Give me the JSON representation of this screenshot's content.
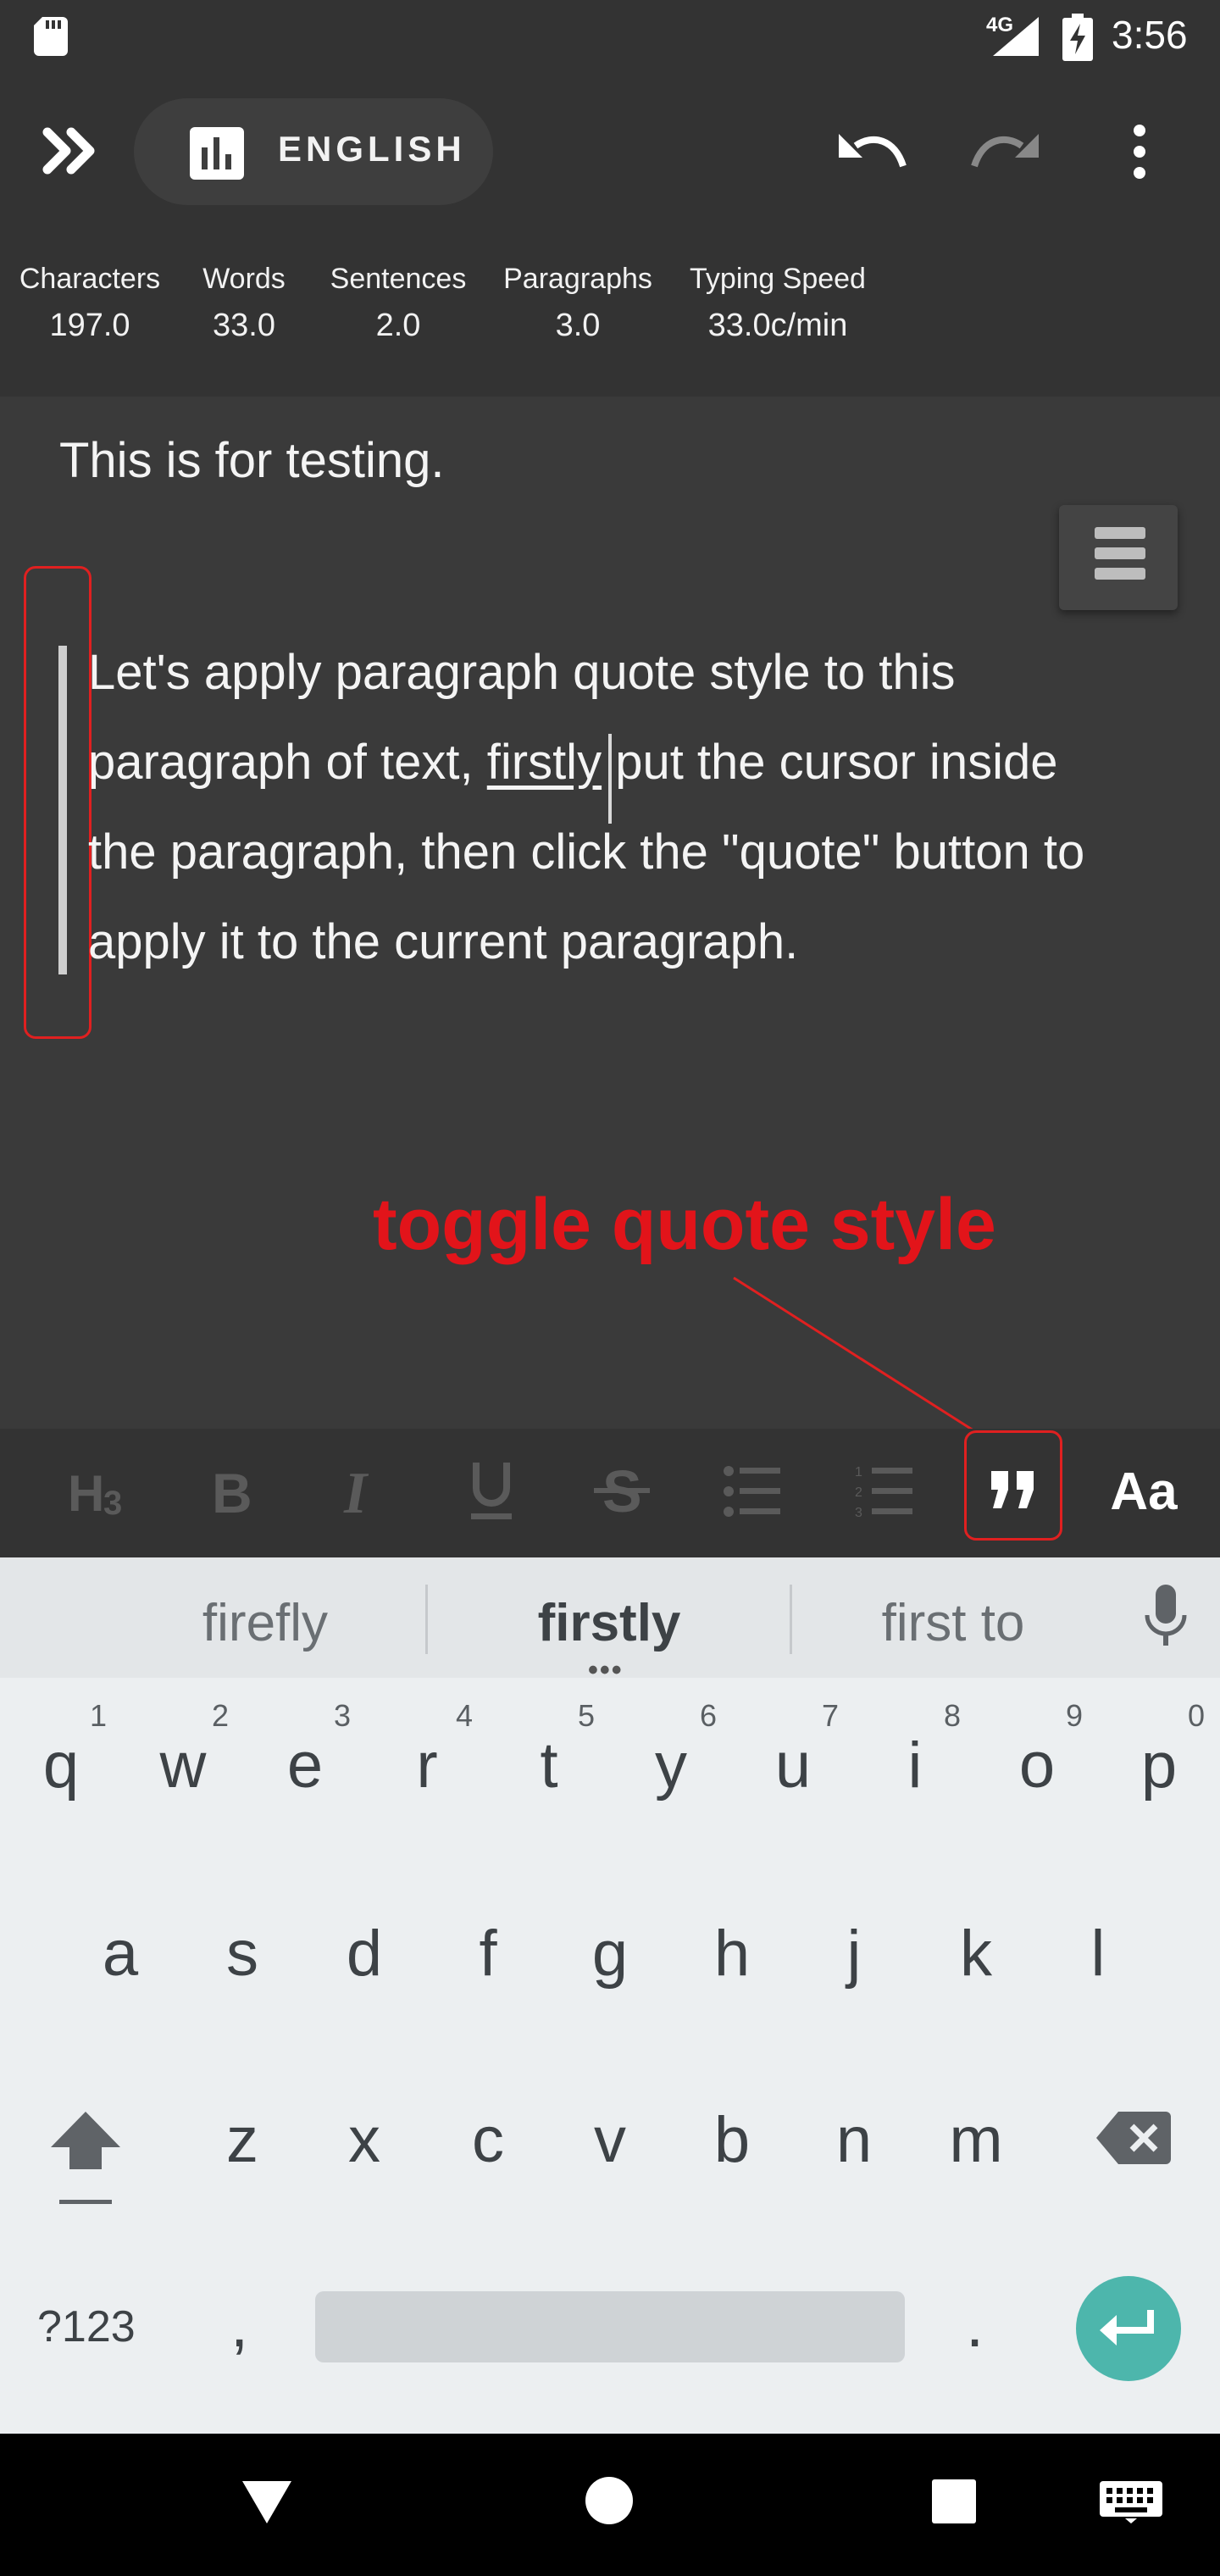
{
  "status_bar": {
    "network": "4G",
    "time": "3:56"
  },
  "toolbar": {
    "language_label": "ENGLISH",
    "icons": [
      "expand-icon",
      "bar-chart-icon",
      "undo-icon",
      "redo-icon",
      "more-vert-icon"
    ]
  },
  "stats": [
    {
      "label": "Characters",
      "value": "197.0"
    },
    {
      "label": "Words",
      "value": "33.0"
    },
    {
      "label": "Sentences",
      "value": "2.0"
    },
    {
      "label": "Paragraphs",
      "value": "3.0"
    },
    {
      "label": "Typing Speed",
      "value": "33.0c/min"
    }
  ],
  "editor": {
    "line1": "This is for testing.",
    "quote_lines": [
      "Let's apply paragraph quote style to this",
      "paragraph of text, ",
      "firstly",
      " put the cursor inside",
      "the paragraph, then click the \"quote\" button to",
      "apply it to the current paragraph."
    ]
  },
  "annotation": {
    "text": "toggle quote style",
    "color": "#e2141a"
  },
  "format_bar": {
    "buttons": [
      "heading-3-icon",
      "bold-icon",
      "italic-icon",
      "underline-icon",
      "strikethrough-icon",
      "bulleted-list-icon",
      "numbered-list-icon",
      "quote-icon",
      "text-style-icon"
    ],
    "text_style_label": "Aa"
  },
  "keyboard": {
    "suggestions": [
      "firefly",
      "firstly",
      "first to"
    ],
    "row1": [
      "q",
      "w",
      "e",
      "r",
      "t",
      "y",
      "u",
      "i",
      "o",
      "p"
    ],
    "row1_hints": [
      "1",
      "2",
      "3",
      "4",
      "5",
      "6",
      "7",
      "8",
      "9",
      "0"
    ],
    "row2": [
      "a",
      "s",
      "d",
      "f",
      "g",
      "h",
      "j",
      "k",
      "l"
    ],
    "row3": [
      "z",
      "x",
      "c",
      "v",
      "b",
      "n",
      "m"
    ],
    "symbols_label": "?123",
    "comma": ",",
    "period": ".",
    "enter_color": "#4db6ac"
  },
  "colors": {
    "background": "#3a3a3a",
    "toolbar": "#333333",
    "keyboard": "#eceff1",
    "highlight": "#e02020"
  }
}
